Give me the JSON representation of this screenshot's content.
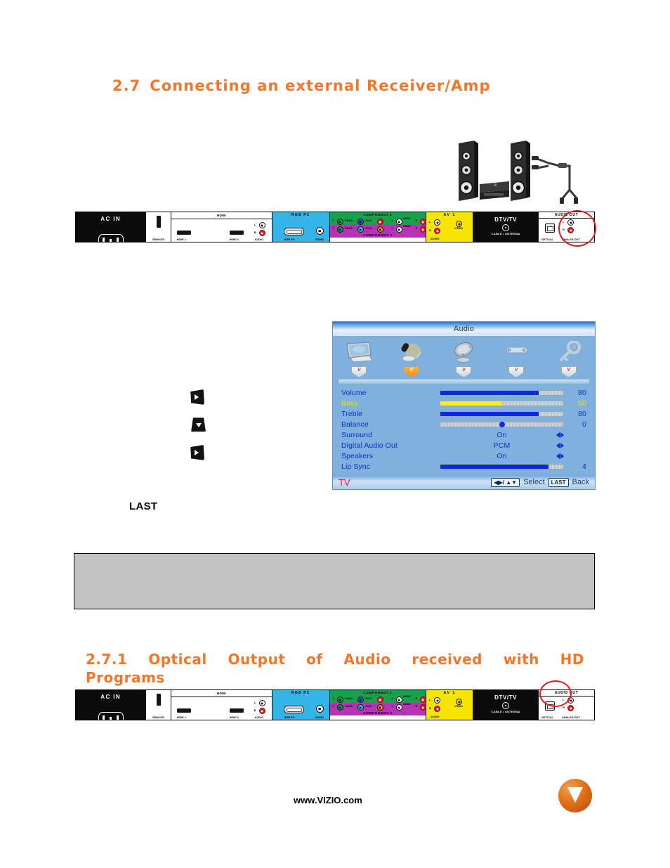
{
  "document": {
    "section_27": {
      "number": "2.7",
      "title": "Connecting an external Receiver/Amp"
    },
    "section_271": {
      "number": "2.7.1",
      "line1_words": [
        "Optical",
        "Output",
        "of",
        "Audio",
        "received",
        "with",
        "HD"
      ],
      "line2": "Programs"
    },
    "note_box": {
      "text": ""
    },
    "remote_key_label": "LAST",
    "footer": {
      "url": "www.VIZIO.com",
      "logo_letter": "V"
    }
  },
  "illustration": {
    "speaker_system": "external-receiver-amp-with-speakers-and-rca-cable"
  },
  "connector_panel": {
    "zones": [
      {
        "name": "ac-in",
        "title": "AC IN"
      },
      {
        "name": "service",
        "title": "",
        "label": "SERVICE"
      },
      {
        "name": "hdmi",
        "title": "HDMI",
        "ports": [
          "HDMI 1",
          "HDMI 2"
        ],
        "audio": {
          "l": "L",
          "r": "R",
          "label": "AUDIO"
        }
      },
      {
        "name": "rgb-pc",
        "title": "RGB PC",
        "port_label": "RGB PC",
        "audio_label": "AUDIO"
      },
      {
        "name": "component",
        "title1": "COMPONENT 1",
        "title2": "COMPONENT 2",
        "jacks": [
          "Y",
          "Pb/Cb",
          "Pr/Cr"
        ],
        "audio": {
          "l": "L",
          "r": "R",
          "label": "AUDIO"
        }
      },
      {
        "name": "av1",
        "title": "AV 1",
        "l": "L",
        "r": "R",
        "audio_label": "AUDIO",
        "video_label": "VIDEO"
      },
      {
        "name": "dtv-tv",
        "title": "DTV/TV",
        "sub": "CABLE / ANTENNA"
      },
      {
        "name": "audio-out",
        "title": "AUDIO OUT",
        "optical_label": "OPTICAL",
        "analog_label": "ANALOG OUT",
        "l": "L",
        "r": "R"
      }
    ]
  },
  "osd_menu": {
    "title": "Audio",
    "categories": [
      {
        "name": "picture",
        "icon": "tv-monitor-icon",
        "active": false
      },
      {
        "name": "audio",
        "icon": "microphone-icon",
        "active": true
      },
      {
        "name": "tuner",
        "icon": "satellite-dish-icon",
        "active": false
      },
      {
        "name": "setup",
        "icon": "wrench-icon",
        "active": false
      },
      {
        "name": "parental",
        "icon": "key-icon",
        "active": false
      }
    ],
    "rows": [
      {
        "label": "Volume",
        "type": "bar",
        "value": "80",
        "percent": 80,
        "selected": false
      },
      {
        "label": "Bass",
        "type": "bar",
        "value": "50",
        "percent": 50,
        "selected": true
      },
      {
        "label": "Treble",
        "type": "bar",
        "value": "80",
        "percent": 80,
        "selected": false
      },
      {
        "label": "Balance",
        "type": "slider",
        "value": "0",
        "percent": 50,
        "selected": false
      },
      {
        "label": "Surround",
        "type": "option",
        "value": "On",
        "selected": false
      },
      {
        "label": "Digital Audio Out",
        "type": "option",
        "value": "PCM",
        "selected": false
      },
      {
        "label": "Speakers",
        "type": "option",
        "value": "On",
        "selected": false
      },
      {
        "label": "Lip Sync",
        "type": "bar",
        "value": "4",
        "percent": 88,
        "selected": false
      }
    ],
    "footer": {
      "source": "TV",
      "select_key": "◀▶/ ▲▼",
      "select_label": "Select",
      "back_key": "LAST",
      "back_label": "Back"
    }
  },
  "colors": {
    "heading_orange": "#F4762A",
    "highlight_red": "#e11b1b",
    "osd_background": "#7fb0de",
    "osd_text_blue": "#0c2fc8",
    "osd_selected_yellow": "#f2e200",
    "rgb_pc_blue": "#35b4e8",
    "component1_green": "#18a04b",
    "component2_magenta": "#b434b5",
    "av1_yellow": "#f6e500",
    "note_box_gray": "#c2c2c2"
  }
}
